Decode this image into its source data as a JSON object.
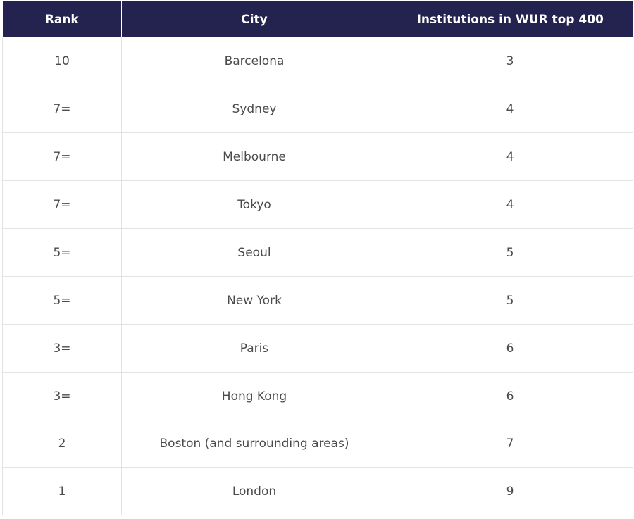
{
  "colors": {
    "header_background": "#24224f",
    "header_text": "#ffffff",
    "body_text": "#4a4a4a",
    "grid_line": "#e2e2e2"
  },
  "chart_data": {
    "type": "table",
    "columns": [
      "Rank",
      "City",
      "Institutions in WUR top 400"
    ],
    "rows": [
      [
        "10",
        "Barcelona",
        "3"
      ],
      [
        "7=",
        "Sydney",
        "4"
      ],
      [
        "7=",
        "Melbourne",
        "4"
      ],
      [
        "7=",
        "Tokyo",
        "4"
      ],
      [
        "5=",
        "Seoul",
        "5"
      ],
      [
        "5=",
        "New York",
        "5"
      ],
      [
        "3=",
        "Paris",
        "6"
      ],
      [
        "3=",
        "Hong Kong",
        "6"
      ],
      [
        "2",
        "Boston (and surrounding areas)",
        "7"
      ],
      [
        "1",
        "London",
        "9"
      ]
    ]
  }
}
